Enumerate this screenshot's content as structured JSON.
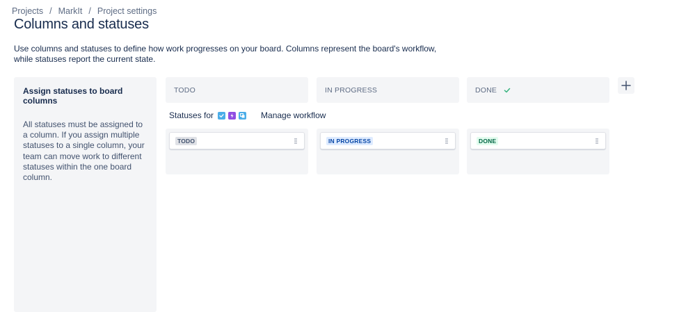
{
  "breadcrumb": {
    "items": [
      "Projects",
      "MarkIt",
      "Project settings"
    ],
    "separator": "/"
  },
  "page": {
    "title": "Columns and statuses",
    "description": "Use columns and statuses to define how work progresses on your board. Columns represent the board's workflow, while statuses report the current state."
  },
  "side_panel": {
    "title": "Assign statuses to board columns",
    "text": "All statuses must be assigned to a column. If you assign multiple statuses to a single column, your team can move work to different statuses within the one board column."
  },
  "columns": [
    {
      "name": "TODO",
      "status": "TODO",
      "is_done": false
    },
    {
      "name": "IN PROGRESS",
      "status": "IN PROGRESS",
      "is_done": false
    },
    {
      "name": "DONE",
      "status": "DONE",
      "is_done": true
    }
  ],
  "statuses_for": {
    "label": "Statuses for",
    "issue_type_icons": [
      "task-icon",
      "epic-icon",
      "subtask-icon"
    ],
    "manage_link": "Manage workflow"
  },
  "colors": {
    "panel_bg": "#f4f5f7",
    "task": "#4bade8",
    "epic": "#904ee2",
    "subtask": "#4bade8",
    "done_check": "#36b37e"
  }
}
